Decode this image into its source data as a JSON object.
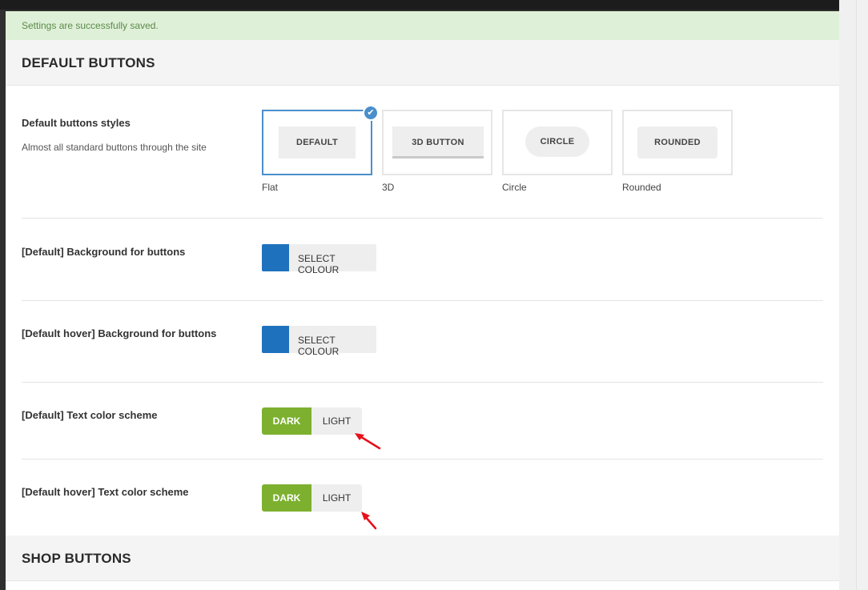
{
  "notice": {
    "text": "Settings are successfully saved."
  },
  "sections": {
    "default": {
      "title": "DEFAULT BUTTONS"
    },
    "shop": {
      "title": "SHOP BUTTONS"
    }
  },
  "button_styles": {
    "label": "Default buttons styles",
    "description": "Almost all standard buttons through the site",
    "options": [
      {
        "preview": "DEFAULT",
        "caption": "Flat",
        "selected": true
      },
      {
        "preview": "3D BUTTON",
        "caption": "3D",
        "selected": false
      },
      {
        "preview": "CIRCLE",
        "caption": "Circle",
        "selected": false
      },
      {
        "preview": "ROUNDED",
        "caption": "Rounded",
        "selected": false
      }
    ]
  },
  "bg_buttons": {
    "label": "[Default] Background for buttons",
    "picker_label": "SELECT COLOUR",
    "color": "#1e72bd"
  },
  "bg_hover_buttons": {
    "label": "[Default hover] Background for buttons",
    "picker_label": "SELECT COLOUR",
    "color": "#1e72bd"
  },
  "text_scheme": {
    "label": "[Default] Text color scheme",
    "dark": "DARK",
    "light": "LIGHT",
    "selected": "dark"
  },
  "text_hover_scheme": {
    "label": "[Default hover] Text color scheme",
    "dark": "DARK",
    "light": "LIGHT",
    "selected": "dark"
  },
  "colors": {
    "accent_blue": "#4a8fcb",
    "toggle_green": "#7db02e",
    "annotation_red": "#e8101a"
  }
}
